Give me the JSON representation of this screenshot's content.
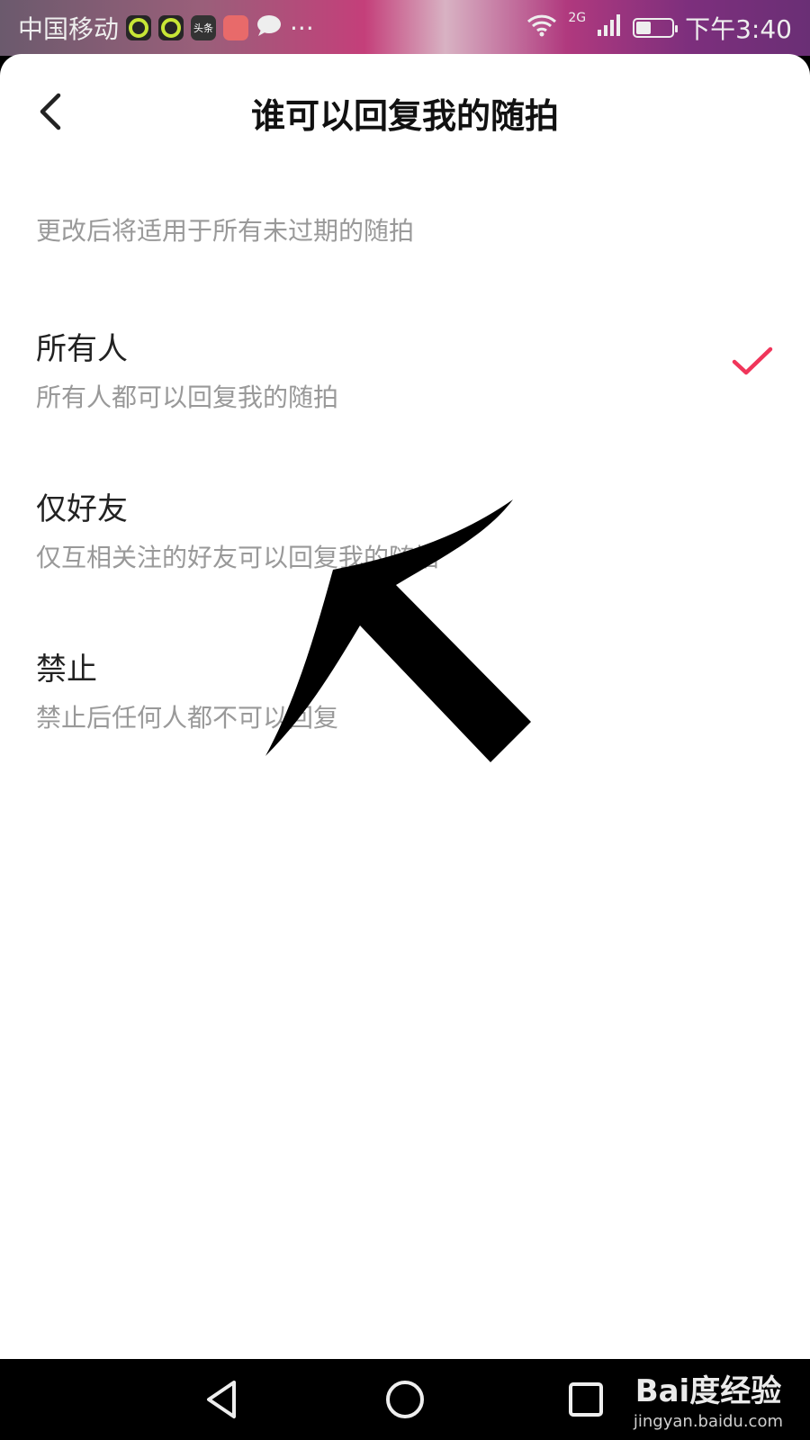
{
  "status_bar": {
    "carrier": "中国移动",
    "app_icons": [
      "ring-app-icon",
      "ring-app-icon",
      "toutiao-icon",
      "red-app-icon",
      "chat-bubble-icon"
    ],
    "toutiao_label": "头条",
    "more": "···",
    "network": "2G",
    "time": "下午3:40"
  },
  "header": {
    "back_icon": "chevron-left-icon",
    "title": "谁可以回复我的随拍"
  },
  "hint": "更改后将适用于所有未过期的随拍",
  "options": [
    {
      "title": "所有人",
      "description": "所有人都可以回复我的随拍",
      "selected": true
    },
    {
      "title": "仅好友",
      "description": "仅互相关注的好友可以回复我的随拍",
      "selected": false
    },
    {
      "title": "禁止",
      "description": "禁止后任何人都不可以回复",
      "selected": false
    }
  ],
  "colors": {
    "accent": "#f0355a",
    "title_text": "#111111",
    "secondary_text": "#999999"
  },
  "system_nav": {
    "keys": [
      "back-triangle-icon",
      "home-circle-icon",
      "recents-square-icon"
    ]
  },
  "watermark": {
    "logo": "Bai度经验",
    "url": "jingyan.baidu.com"
  }
}
